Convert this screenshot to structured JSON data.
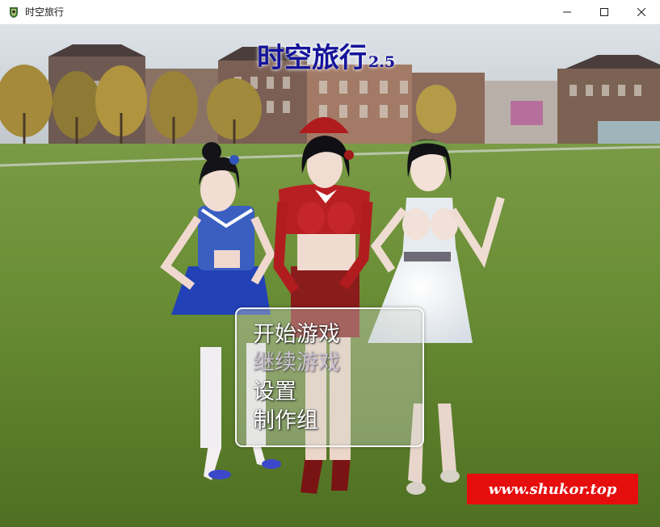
{
  "window": {
    "title": "时空旅行",
    "app_icon": "game-app-icon",
    "controls": [
      "minimize-icon",
      "maximize-icon",
      "close-icon"
    ]
  },
  "game": {
    "title": "时空旅行",
    "version": "2.5",
    "title_color": "#15149a"
  },
  "menu": {
    "items": [
      {
        "label": "开始游戏",
        "enabled": true
      },
      {
        "label": "继续游戏",
        "enabled": false
      },
      {
        "label": "设置",
        "enabled": true
      },
      {
        "label": "制作组",
        "enabled": true
      }
    ]
  },
  "watermark": {
    "text": "www.shukor.top",
    "background": "#e60d0d"
  },
  "scene": {
    "characters": [
      {
        "name": "girl-blue-outfit",
        "outfit": "blue plaid school uniform"
      },
      {
        "name": "girl-red-outfit",
        "outfit": "red santa outfit"
      },
      {
        "name": "girl-white-outfit",
        "outfit": "white dress with leaf crown"
      }
    ]
  }
}
